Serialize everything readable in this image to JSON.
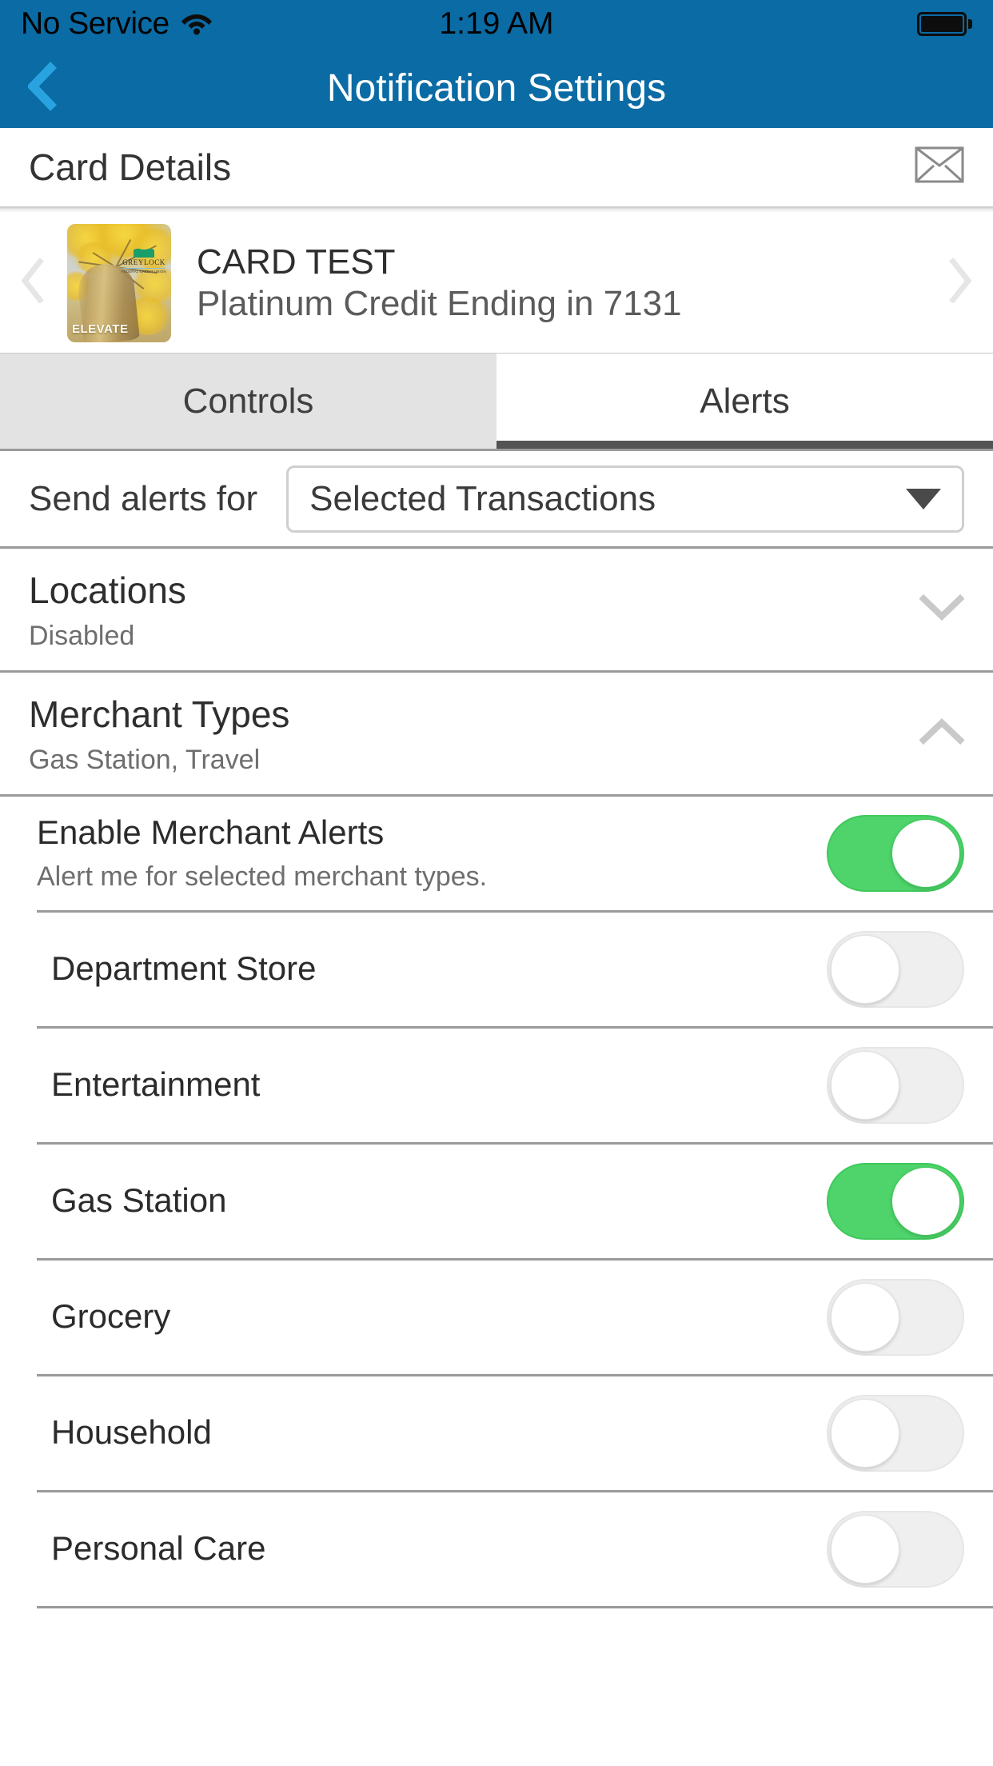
{
  "status_bar": {
    "carrier": "No Service",
    "time": "1:19 AM",
    "wifi_icon": "wifi-icon",
    "battery_icon": "battery-full-icon"
  },
  "nav": {
    "back_icon": "chevron-left-icon",
    "title": "Notification Settings"
  },
  "card_details": {
    "heading": "Card Details",
    "mail_icon": "envelope-icon"
  },
  "carousel": {
    "prev_icon": "chevron-left-icon",
    "next_icon": "chevron-right-icon",
    "card_art": {
      "brand_name": "GREYLOCK",
      "brand_sub": "FEDERAL CREDIT UNION",
      "program_name": "ELEVATE",
      "logo_icon": "mountain-logo-icon"
    },
    "card_name": "CARD TEST",
    "card_description": "Platinum Credit Ending in 7131"
  },
  "tabs": [
    {
      "label": "Controls",
      "active": false
    },
    {
      "label": "Alerts",
      "active": true
    }
  ],
  "send_alerts": {
    "label": "Send alerts for",
    "selected_value": "Selected Transactions",
    "caret_icon": "caret-down-icon"
  },
  "sections": [
    {
      "title": "Locations",
      "subtitle": "Disabled",
      "expanded": false,
      "chevron_icon": "chevron-down-icon"
    },
    {
      "title": "Merchant Types",
      "subtitle": "Gas Station, Travel",
      "expanded": true,
      "chevron_icon": "chevron-up-icon"
    }
  ],
  "merchant_enable": {
    "title": "Enable Merchant Alerts",
    "subtitle": "Alert me for selected merchant types.",
    "toggle_state": "on"
  },
  "merchant_types": [
    {
      "label": "Department Store",
      "toggle_state": "off"
    },
    {
      "label": "Entertainment",
      "toggle_state": "off"
    },
    {
      "label": "Gas Station",
      "toggle_state": "on"
    },
    {
      "label": "Grocery",
      "toggle_state": "off"
    },
    {
      "label": "Household",
      "toggle_state": "off"
    },
    {
      "label": "Personal Care",
      "toggle_state": "off"
    }
  ],
  "colors": {
    "header_blue": "#0b6ba4",
    "back_arrow_blue": "#29a3e0",
    "toggle_on_green": "#4ed46a",
    "toggle_off_gray": "#efefef",
    "divider_gray": "#9a9a9a",
    "tab_inactive_bg": "#e3e3e3",
    "tab_indicator": "#545454"
  }
}
